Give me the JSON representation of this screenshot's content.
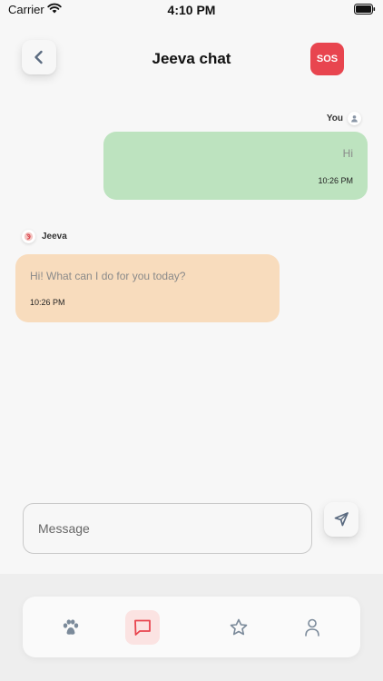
{
  "status_bar": {
    "carrier": "Carrier",
    "time": "4:10 PM"
  },
  "header": {
    "title": "Jeeva chat",
    "sos_label": "SOS",
    "back_icon": "chevron-left-icon"
  },
  "chat": {
    "messages": [
      {
        "sender": "You",
        "text": "Hi",
        "time": "10:26 PM",
        "direction": "outgoing",
        "color": "#bde3bf"
      },
      {
        "sender": "Jeeva",
        "text": "Hi! What can I do for you today?",
        "time": "10:26 PM",
        "direction": "incoming",
        "color": "#f8dcbd"
      }
    ]
  },
  "composer": {
    "placeholder": "Message",
    "send_icon": "send-icon"
  },
  "bottom_nav": {
    "items": [
      {
        "icon": "paw-icon",
        "active": false
      },
      {
        "icon": "chat-icon",
        "active": true
      },
      {
        "icon": "star-icon",
        "active": false
      },
      {
        "icon": "profile-icon",
        "active": false
      }
    ]
  },
  "colors": {
    "sos": "#e8454f",
    "background": "#f7f7f7",
    "active_tab": "#fbe3e2",
    "active_icon": "#e8454f",
    "inactive_icon": "#7b8a9a"
  }
}
